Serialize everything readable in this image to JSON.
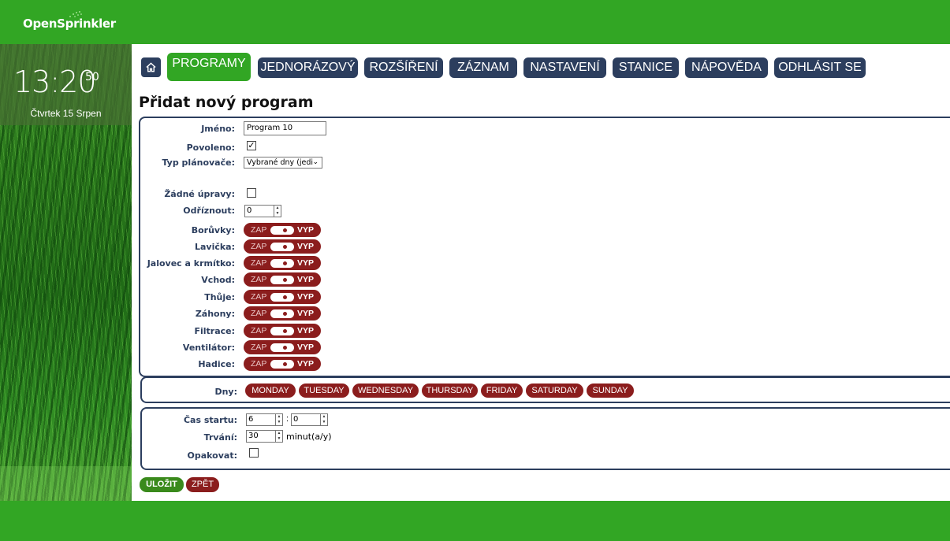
{
  "header": {
    "logo_text": "OpenSprinkler",
    "brand_color": "#32a624"
  },
  "clock": {
    "time": "13:20",
    "seconds": "50",
    "date": "Čtvrtek 15 Srpen"
  },
  "nav": {
    "home_icon": "home-icon",
    "items": [
      {
        "label": "PROGRAMY",
        "active": true
      },
      {
        "label": "JEDNORÁZOVÝ"
      },
      {
        "label": "ROZŠÍŘENÍ"
      },
      {
        "label": "ZÁZNAM"
      },
      {
        "label": "NASTAVENÍ"
      },
      {
        "label": "STANICE"
      },
      {
        "label": "NÁPOVĚDA"
      },
      {
        "label": "ODHLÁSIT SE"
      }
    ]
  },
  "page_title": "Přidat nový program",
  "form": {
    "name_label": "Jméno:",
    "name_value": "Program 10",
    "enabled_label": "Povoleno:",
    "enabled_checked": true,
    "scheduler_label": "Typ plánovače:",
    "scheduler_value": "Vybrané dny (jedi",
    "no_adjust_label": "Žádné úpravy:",
    "no_adjust_checked": false,
    "cutoff_label": "Odříznout:",
    "cutoff_value": "0",
    "toggle_on": "ZAP",
    "toggle_off": "VYP",
    "stations": [
      {
        "label": "Borůvky:"
      },
      {
        "label": "Lavička:"
      },
      {
        "label": "Jalovec a krmítko:"
      },
      {
        "label": "Vchod:"
      },
      {
        "label": "Thůje:"
      },
      {
        "label": "Záhony:"
      },
      {
        "label": "Filtrace:"
      },
      {
        "label": "Ventilátor:"
      },
      {
        "label": "Hadice:"
      }
    ],
    "days_label": "Dny:",
    "days": [
      "MONDAY",
      "TUESDAY",
      "WEDNESDAY",
      "THURSDAY",
      "FRIDAY",
      "SATURDAY",
      "SUNDAY"
    ],
    "start_label": "Čas startu:",
    "start_hour": "6",
    "time_separator": ":",
    "start_minute": "0",
    "duration_label": "Trvání:",
    "duration_value": "30",
    "duration_unit": "minut(a/y)",
    "repeat_label": "Opakovat:",
    "repeat_checked": false
  },
  "actions": {
    "save_label": "ULOŽIT",
    "back_label": "ZPĚT",
    "save_color": "#3a8a1c",
    "back_color": "#8b1d1d"
  },
  "colors": {
    "navy": "#2c3e5e",
    "toggle_red": "#8b1d1d"
  }
}
